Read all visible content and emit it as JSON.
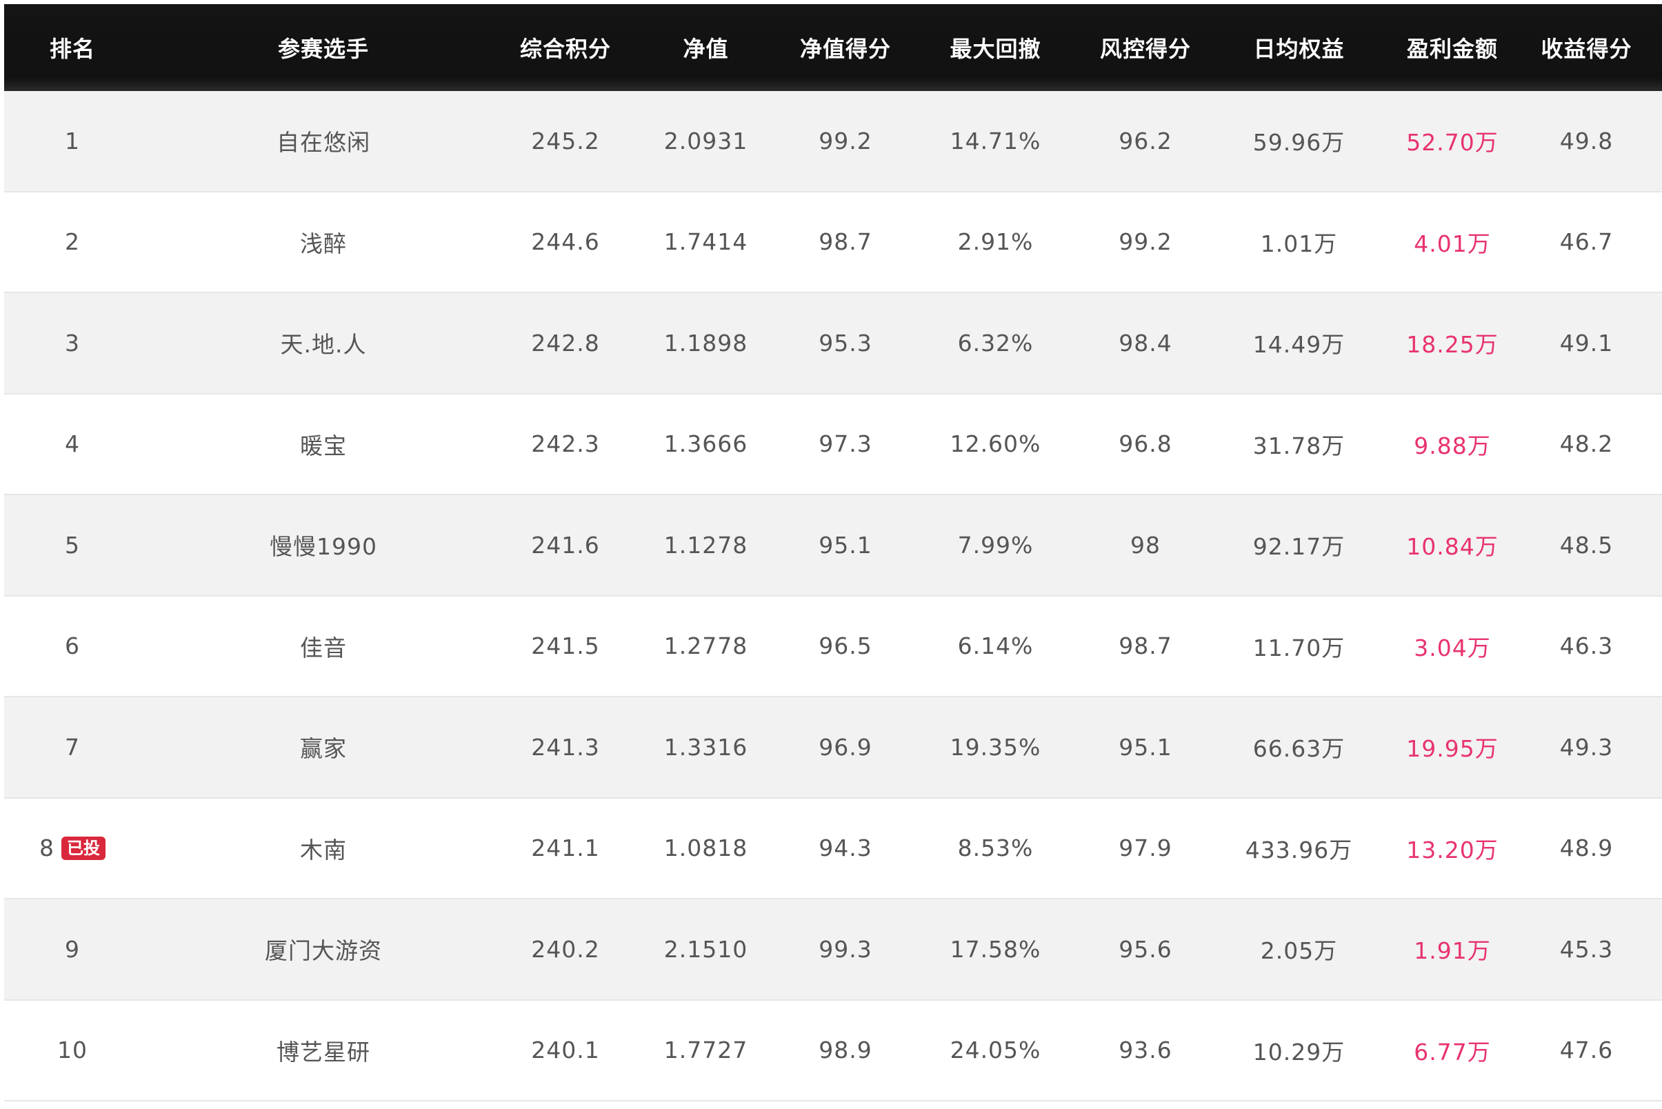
{
  "headers": [
    "排名",
    "参赛选手",
    "综合积分",
    "净值",
    "净值得分",
    "最大回撤",
    "风控得分",
    "日均权益",
    "盈利金额",
    "收益得分"
  ],
  "rows": [
    {
      "rank": "1",
      "badge": "",
      "player": "自在悠闲",
      "score": "245.2",
      "nav": "2.0931",
      "nav_score": "99.2",
      "max_drawdown": "14.71%",
      "risk_score": "96.2",
      "avg_equity": "59.96万",
      "profit": "52.70万",
      "return_score": "49.8"
    },
    {
      "rank": "2",
      "badge": "",
      "player": "浅醉",
      "score": "244.6",
      "nav": "1.7414",
      "nav_score": "98.7",
      "max_drawdown": "2.91%",
      "risk_score": "99.2",
      "avg_equity": "1.01万",
      "profit": "4.01万",
      "return_score": "46.7"
    },
    {
      "rank": "3",
      "badge": "",
      "player": "天.地.人",
      "score": "242.8",
      "nav": "1.1898",
      "nav_score": "95.3",
      "max_drawdown": "6.32%",
      "risk_score": "98.4",
      "avg_equity": "14.49万",
      "profit": "18.25万",
      "return_score": "49.1"
    },
    {
      "rank": "4",
      "badge": "",
      "player": "暖宝",
      "score": "242.3",
      "nav": "1.3666",
      "nav_score": "97.3",
      "max_drawdown": "12.60%",
      "risk_score": "96.8",
      "avg_equity": "31.78万",
      "profit": "9.88万",
      "return_score": "48.2"
    },
    {
      "rank": "5",
      "badge": "",
      "player": "慢慢1990",
      "score": "241.6",
      "nav": "1.1278",
      "nav_score": "95.1",
      "max_drawdown": "7.99%",
      "risk_score": "98",
      "avg_equity": "92.17万",
      "profit": "10.84万",
      "return_score": "48.5"
    },
    {
      "rank": "6",
      "badge": "",
      "player": "佳音",
      "score": "241.5",
      "nav": "1.2778",
      "nav_score": "96.5",
      "max_drawdown": "6.14%",
      "risk_score": "98.7",
      "avg_equity": "11.70万",
      "profit": "3.04万",
      "return_score": "46.3"
    },
    {
      "rank": "7",
      "badge": "",
      "player": "赢家",
      "score": "241.3",
      "nav": "1.3316",
      "nav_score": "96.9",
      "max_drawdown": "19.35%",
      "risk_score": "95.1",
      "avg_equity": "66.63万",
      "profit": "19.95万",
      "return_score": "49.3"
    },
    {
      "rank": "8",
      "badge": "已投",
      "player": "木南",
      "score": "241.1",
      "nav": "1.0818",
      "nav_score": "94.3",
      "max_drawdown": "8.53%",
      "risk_score": "97.9",
      "avg_equity": "433.96万",
      "profit": "13.20万",
      "return_score": "48.9"
    },
    {
      "rank": "9",
      "badge": "",
      "player": "厦门大游资",
      "score": "240.2",
      "nav": "2.1510",
      "nav_score": "99.3",
      "max_drawdown": "17.58%",
      "risk_score": "95.6",
      "avg_equity": "2.05万",
      "profit": "1.91万",
      "return_score": "45.3"
    },
    {
      "rank": "10",
      "badge": "",
      "player": "博艺星研",
      "score": "240.1",
      "nav": "1.7727",
      "nav_score": "98.9",
      "max_drawdown": "24.05%",
      "risk_score": "93.6",
      "avg_equity": "10.29万",
      "profit": "6.77万",
      "return_score": "47.6"
    }
  ],
  "colors": {
    "header_bg": "#111111",
    "header_text": "#ffffff",
    "row_odd": "#f2f2f2",
    "row_even": "#ffffff",
    "text": "#555555",
    "profit": "#e8336d",
    "badge": "#d9283c"
  }
}
